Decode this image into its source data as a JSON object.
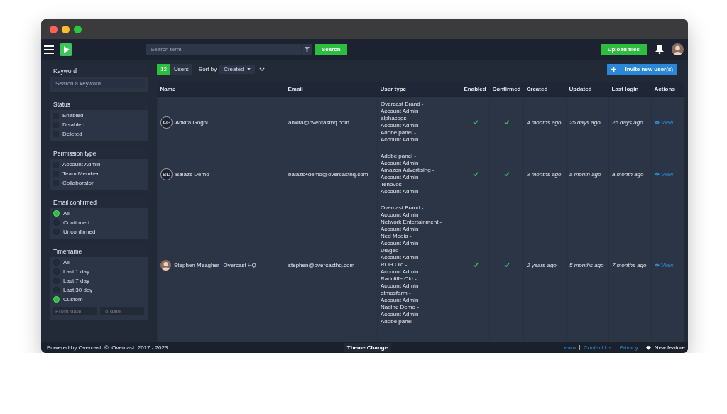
{
  "header": {
    "search": {
      "placeholder": "Search term"
    },
    "search_button": "Search",
    "upload_button": "Upload files"
  },
  "sidebar": {
    "keyword": {
      "title": "Keyword",
      "placeholder": "Search a keyword"
    },
    "groups": [
      {
        "title": "Status",
        "kind": "checkbox",
        "options": [
          {
            "label": "Enabled",
            "checked": false
          },
          {
            "label": "Disabled",
            "checked": false
          },
          {
            "label": "Deleted",
            "checked": false
          }
        ]
      },
      {
        "title": "Permission type",
        "kind": "checkbox",
        "options": [
          {
            "label": "Account Admin",
            "checked": false
          },
          {
            "label": "Team Member",
            "checked": false
          },
          {
            "label": "Collaborator",
            "checked": false
          }
        ]
      },
      {
        "title": "Email confirmed",
        "kind": "radio",
        "options": [
          {
            "label": "All",
            "selected": true
          },
          {
            "label": "Confirmed",
            "selected": false
          },
          {
            "label": "Unconfirmed",
            "selected": false
          }
        ]
      },
      {
        "title": "Timeframe",
        "kind": "radio",
        "options": [
          {
            "label": "All",
            "selected": false
          },
          {
            "label": "Last 1 day",
            "selected": false
          },
          {
            "label": "Last 7 day",
            "selected": false
          },
          {
            "label": "Last 30 day",
            "selected": false
          },
          {
            "label": "Custom",
            "selected": true
          }
        ],
        "from_placeholder": "From date",
        "to_placeholder": "To date"
      }
    ]
  },
  "toolbar": {
    "count": "12",
    "count_label": "Users",
    "sort_label": "Sort by",
    "sort_value": "Created",
    "invite_button": "Invite new user(s)"
  },
  "table": {
    "columns": [
      "Name",
      "Email",
      "User type",
      "Enabled",
      "Confirmed",
      "Created",
      "Updated",
      "Last login",
      "Actions"
    ],
    "rows": [
      {
        "avatar": {
          "kind": "initials",
          "text": "AG"
        },
        "name": "Ankita Gogoi",
        "email": "ankita@overcasthq.com",
        "user_types": [
          [
            "Overcast Brand -",
            "Account Admin"
          ],
          [
            "alphacogs -",
            "Account Admin"
          ],
          [
            "Adobe panel -",
            "Account Admin"
          ]
        ],
        "enabled": true,
        "confirmed": true,
        "created": "4 months ago",
        "updated": "25 days ago",
        "last_login": "25 days ago",
        "action": "View"
      },
      {
        "avatar": {
          "kind": "initials",
          "text": "BD"
        },
        "name": "Balazs Demo",
        "email": "balazs+demo@overcasthq.com",
        "user_types": [
          [
            "Adobe panel -",
            "Account Admin"
          ],
          [
            "Amazon Advertising -",
            "Account Admin"
          ],
          [
            "Tenovos -",
            "Account Admin"
          ]
        ],
        "enabled": true,
        "confirmed": true,
        "created": "8 months ago",
        "updated": "a month ago",
        "last_login": "a month ago",
        "action": "View"
      },
      {
        "avatar": {
          "kind": "picture"
        },
        "name": "Stephen Meagher",
        "org": "Overcast HQ",
        "email": "stephen@overcasthq.com",
        "user_types": [
          [
            "Overcast Brand -",
            "Account Admin"
          ],
          [
            "Network Entertainment -",
            "Account Admin"
          ],
          [
            "Ned Media -",
            "Account Admin"
          ],
          [
            "Diageo -",
            "Account Admin"
          ],
          [
            "ROH Old -",
            "Account Admin"
          ],
          [
            "Radcliffe Old -",
            "Account Admin"
          ],
          [
            "atmosfarm -",
            "Account Admin"
          ],
          [
            "Nadine Demo -",
            "Account Admin"
          ],
          [
            "Adobe panel -"
          ]
        ],
        "enabled": true,
        "confirmed": true,
        "created": "2 years ago",
        "updated": "5 months ago",
        "last_login": "7 months ago",
        "action": "View"
      }
    ]
  },
  "footer": {
    "copyright": "Powered by Overcast  ©  Overcast  2017 - 2023",
    "theme_button": "Theme Change",
    "links": [
      "Learn",
      "Contact Us",
      "Privacy"
    ],
    "new_features": "New feature"
  }
}
